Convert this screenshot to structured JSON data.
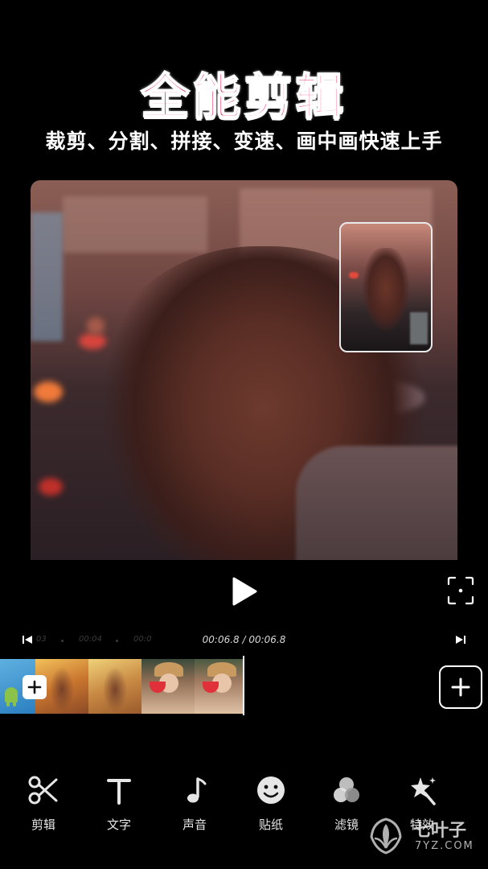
{
  "promo": {
    "headline": "全能剪辑",
    "subtitle": "裁剪、分割、拼接、变速、画中画快速上手"
  },
  "player": {
    "play_icon": "play-icon",
    "fullscreen_icon": "fullscreen-icon"
  },
  "timeline": {
    "current_time": "00:06.8",
    "total_time": "00:06.8",
    "time_readout": "00:06.8 / 00:06.8",
    "ruler_ticks": [
      "03",
      "00:04",
      "00:0"
    ]
  },
  "toolbar": {
    "items": [
      {
        "label": "剪辑",
        "icon": "scissors-icon"
      },
      {
        "label": "文字",
        "icon": "text-icon"
      },
      {
        "label": "声音",
        "icon": "music-note-icon"
      },
      {
        "label": "贴纸",
        "icon": "smiley-sticker-icon"
      },
      {
        "label": "滤镜",
        "icon": "filter-circles-icon"
      },
      {
        "label": "特效",
        "icon": "magic-wand-icon"
      }
    ]
  },
  "watermark": {
    "title": "七叶子",
    "subtitle": "7YZ.COM"
  },
  "colors": {
    "accent": "#ee1d4f",
    "background": "#000000"
  }
}
